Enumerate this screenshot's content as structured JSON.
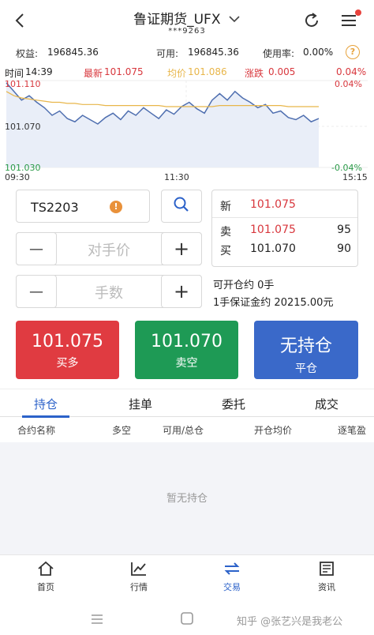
{
  "header": {
    "title": "鲁证期货_UFX",
    "account_masked": "***9263"
  },
  "account": {
    "equity_label": "权益:",
    "equity_value": "196845.36",
    "available_label": "可用:",
    "available_value": "196845.36",
    "usage_label": "使用率:",
    "usage_value": "0.00%",
    "help_glyph": "?"
  },
  "chart_info": {
    "time_label": "时间",
    "time_value": "14:39",
    "latest_label": "最新",
    "latest_value": "101.075",
    "avg_label": "均价",
    "avg_value": "101.086",
    "change_label": "涨跌",
    "change_value": "0.005",
    "change_pct": "0.04%",
    "price_top": "101.110",
    "price_mid": "101.070",
    "price_bottom": "101.030",
    "pct_top": "0.04%",
    "pct_bottom": "-0.04%",
    "time_start": "09:30",
    "time_mid": "11:30",
    "time_end": "15:15",
    "colors": {
      "latest": "#d8373d",
      "avg": "#e8b64a",
      "line": "#4f6fb0",
      "pos": "#d8373d",
      "neg": "#2a9a48"
    }
  },
  "chart_data": {
    "type": "line",
    "series": [
      {
        "name": "最新",
        "values": [
          101.108,
          101.1,
          101.092,
          101.096,
          101.09,
          101.085,
          101.078,
          101.082,
          101.075,
          101.072,
          101.078,
          101.074,
          101.07,
          101.076,
          101.08,
          101.074,
          101.082,
          101.078,
          101.085,
          101.08,
          101.075,
          101.083,
          101.079,
          101.086,
          101.09,
          101.084,
          101.08,
          101.092,
          101.098,
          101.092,
          101.1,
          101.094,
          101.09,
          101.085,
          101.088,
          101.08,
          101.082,
          101.076,
          101.074,
          101.078,
          101.072,
          101.075
        ]
      },
      {
        "name": "均价",
        "values": [
          101.1,
          101.096,
          101.094,
          101.093,
          101.092,
          101.091,
          101.09,
          101.09,
          101.089,
          101.089,
          101.088,
          101.088,
          101.088,
          101.087,
          101.087,
          101.087,
          101.087,
          101.087,
          101.087,
          101.087,
          101.087,
          101.086,
          101.086,
          101.086,
          101.086,
          101.086,
          101.086,
          101.086,
          101.087,
          101.087,
          101.087,
          101.087,
          101.087,
          101.087,
          101.087,
          101.087,
          101.087,
          101.086,
          101.086,
          101.086,
          101.086,
          101.086
        ]
      }
    ],
    "ylim": [
      101.03,
      101.11
    ],
    "x_ticks": [
      "09:30",
      "11:30",
      "15:15"
    ]
  },
  "order": {
    "contract": "TS2203",
    "price_placeholder": "对手价",
    "qty_placeholder": "手数",
    "minus": "—",
    "plus": "+"
  },
  "quote": {
    "last_label": "新",
    "last_value": "101.075",
    "ask_label": "卖",
    "ask_value": "101.075",
    "ask_qty": "95",
    "bid_label": "买",
    "bid_value": "101.070",
    "bid_qty": "90"
  },
  "open_info": {
    "open_label": "可开仓约",
    "open_value": "0手",
    "margin_label": "1手保证金约",
    "margin_value": "20215.00元"
  },
  "actions": {
    "buy_price": "101.075",
    "buy_label": "买多",
    "sell_price": "101.070",
    "sell_label": "卖空",
    "flat_title": "无持仓",
    "flat_label": "平仓",
    "colors": {
      "buy": "#e03b41",
      "sell": "#1e9a55",
      "flat": "#3a69c9"
    }
  },
  "tabs": [
    "持仓",
    "挂单",
    "委托",
    "成交"
  ],
  "columns": [
    "合约名称",
    "多空",
    "可用/总仓",
    "开仓均价",
    "逐笔盈"
  ],
  "empty_text": "暂无持仓",
  "nav": [
    "首页",
    "行情",
    "交易",
    "资讯"
  ],
  "watermark": "知乎 @张艺兴是我老公"
}
